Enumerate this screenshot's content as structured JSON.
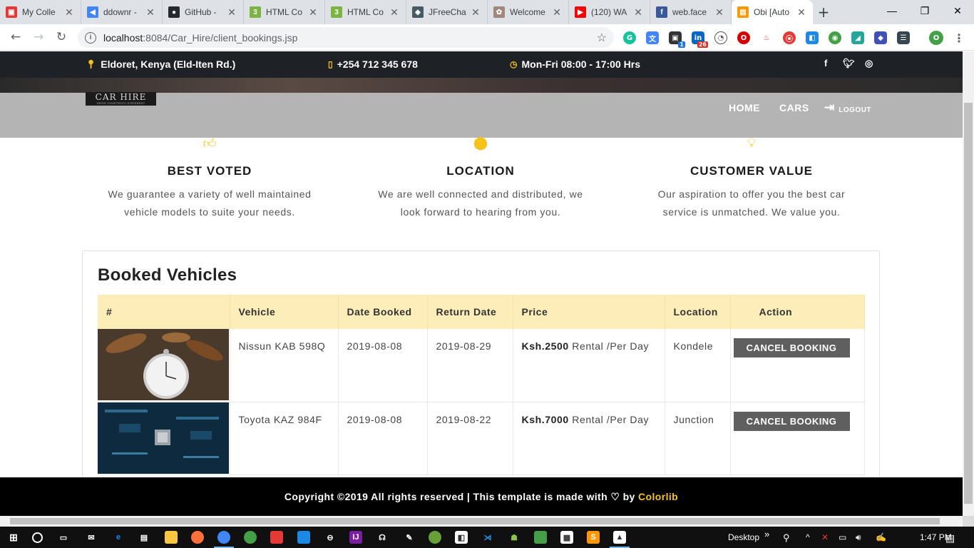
{
  "browser": {
    "tabs": [
      {
        "title": "My Colle",
        "favicon_color": "#e53935",
        "favicon": "▣"
      },
      {
        "title": "ddownr -",
        "favicon_color": "#4285f4",
        "favicon": "◀"
      },
      {
        "title": "GitHub -",
        "favicon_color": "#24292e",
        "favicon": "●"
      },
      {
        "title": "HTML Co",
        "favicon_color": "#7cb342",
        "favicon": "3"
      },
      {
        "title": "HTML Co",
        "favicon_color": "#7cb342",
        "favicon": "3"
      },
      {
        "title": "JFreeCha",
        "favicon_color": "#455a64",
        "favicon": "◈"
      },
      {
        "title": "Welcome",
        "favicon_color": "#a1887f",
        "favicon": "✿"
      },
      {
        "title": "(120) WA",
        "favicon_color": "#ff0000",
        "favicon": "▶"
      },
      {
        "title": "web.face",
        "favicon_color": "#3b5998",
        "favicon": "f"
      },
      {
        "title": "Obi [Auto",
        "favicon_color": "#ff9800",
        "favicon": "▤"
      }
    ],
    "url_host": "localhost",
    "url_path": ":8084/Car_Hire/client_bookings.jsp",
    "profile_initial": "O"
  },
  "site": {
    "address": "Eldoret, Kenya (Eld-Iten Rd.)",
    "phone": "+254 712 345 678",
    "hours": "Mon-Fri 08:00 - 17:00 Hrs",
    "logo_text": "CAR HIRE",
    "logo_tagline": "DRIVE SOMETHING DIFFERENT",
    "nav": {
      "home": "HOME",
      "cars": "CARS",
      "logout": "LOGOUT"
    },
    "accent_color": "#f7c31a"
  },
  "features": [
    {
      "title": "BEST VOTED",
      "line1": "We guarantee a variety of well maintained",
      "line2": "vehicle models to suite your needs."
    },
    {
      "title": "LOCATION",
      "line1": "We are well connected and distributed, we",
      "line2": "look forward to hearing from you."
    },
    {
      "title": "CUSTOMER VALUE",
      "line1": "Our aspiration to offer you the best car",
      "line2": "service is unmatched. We value you."
    }
  ],
  "bookings": {
    "heading": "Booked Vehicles",
    "columns": [
      "#",
      "Vehicle",
      "Date Booked",
      "Return Date",
      "Price",
      "Location",
      "Action"
    ],
    "rows": [
      {
        "vehicle": "Nissun KAB 598Q",
        "date_booked": "2019-08-08",
        "return_date": "2019-08-29",
        "price": "Ksh.2500",
        "price_suffix": " Rental /Per Day",
        "location": "Kondele",
        "action": "CANCEL BOOKING"
      },
      {
        "vehicle": "Toyota KAZ 984F",
        "date_booked": "2019-08-08",
        "return_date": "2019-08-22",
        "price": "Ksh.7000",
        "price_suffix": " Rental /Per Day",
        "location": "Junction",
        "action": "CANCEL BOOKING"
      }
    ]
  },
  "footer": {
    "text_before": "Copyright ©2019 All rights reserved | This template is made with ",
    "text_by": " by ",
    "brand": "Colorlib"
  },
  "taskbar": {
    "desktop_label": "Desktop",
    "time": "1:47 PM"
  }
}
